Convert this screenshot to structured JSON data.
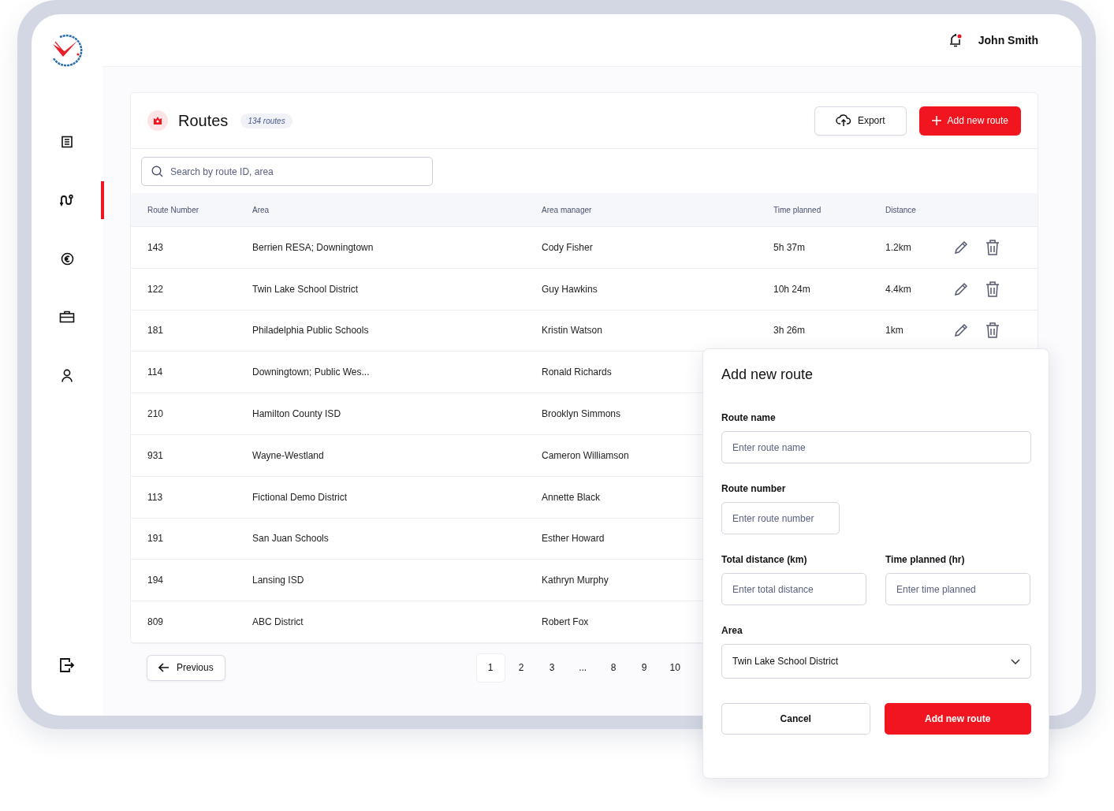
{
  "user": {
    "name": "John Smith",
    "has_notification": true
  },
  "sidebar": {
    "items": [
      {
        "selected": false
      },
      {
        "selected": true
      },
      {
        "selected": false
      },
      {
        "selected": false
      },
      {
        "selected": false
      }
    ]
  },
  "page": {
    "title": "Routes",
    "count_badge": "134 routes",
    "buttons": [
      {
        "kind": "secondary",
        "label": "Export"
      },
      {
        "kind": "primary",
        "label": "Add new route"
      }
    ],
    "search": {
      "placeholder": "Search by route ID, area"
    }
  },
  "table": {
    "columns": [
      "Route Number",
      "Area",
      "Area manager",
      "Time planned",
      "Distance"
    ],
    "rows": [
      {
        "route": "143",
        "area": "Berrien RESA; Downingtown",
        "manager": "Cody Fisher",
        "time": "5h 37m",
        "distance": "1.2km"
      },
      {
        "route": "122",
        "area": "Twin Lake School District",
        "manager": "Guy Hawkins",
        "time": "10h 24m",
        "distance": "4.4km"
      },
      {
        "route": "181",
        "area": "Philadelphia Public Schools",
        "manager": "Kristin Watson",
        "time": "3h 26m",
        "distance": "1km"
      },
      {
        "route": "114",
        "area": "Downingtown; Public Wes...",
        "manager": "Ronald Richards"
      },
      {
        "route": "210",
        "area": "Hamilton County ISD",
        "manager": "Brooklyn Simmons"
      },
      {
        "route": "931",
        "area": "Wayne-Westland",
        "manager": "Cameron Williamson"
      },
      {
        "route": "113",
        "area": "Fictional Demo District",
        "manager": "Annette Black"
      },
      {
        "route": "191",
        "area": "San Juan Schools",
        "manager": "Esther Howard"
      },
      {
        "route": "194",
        "area": "Lansing ISD",
        "manager": "Kathryn Murphy"
      },
      {
        "route": "809",
        "area": "ABC District",
        "manager": "Robert Fox"
      }
    ]
  },
  "pagination": {
    "previous": "Previous",
    "pages": [
      {
        "label": "1",
        "selected": true
      },
      {
        "label": "2",
        "selected": false
      },
      {
        "label": "3",
        "selected": false
      },
      {
        "label": "...",
        "selected": false
      },
      {
        "label": "8",
        "selected": false
      },
      {
        "label": "9",
        "selected": false
      },
      {
        "label": "10",
        "selected": false
      }
    ]
  },
  "modal": {
    "title": "Add new route",
    "fields": [
      {
        "kind": "text",
        "label": "Route name",
        "placeholder": "Enter route name"
      },
      {
        "kind": "short_text",
        "label": "Route number",
        "placeholder": "Enter route number"
      },
      {
        "kind": "text",
        "label": "Total distance (km)",
        "placeholder": "Enter total distance"
      },
      {
        "kind": "text",
        "label": "Time planned (hr)",
        "placeholder": "Enter time planned"
      },
      {
        "kind": "select",
        "label": "Area",
        "value": "Twin Lake School District"
      }
    ],
    "buttons": [
      {
        "kind": "secondary",
        "label": "Cancel"
      },
      {
        "kind": "primary",
        "label": "Add new route"
      }
    ]
  }
}
